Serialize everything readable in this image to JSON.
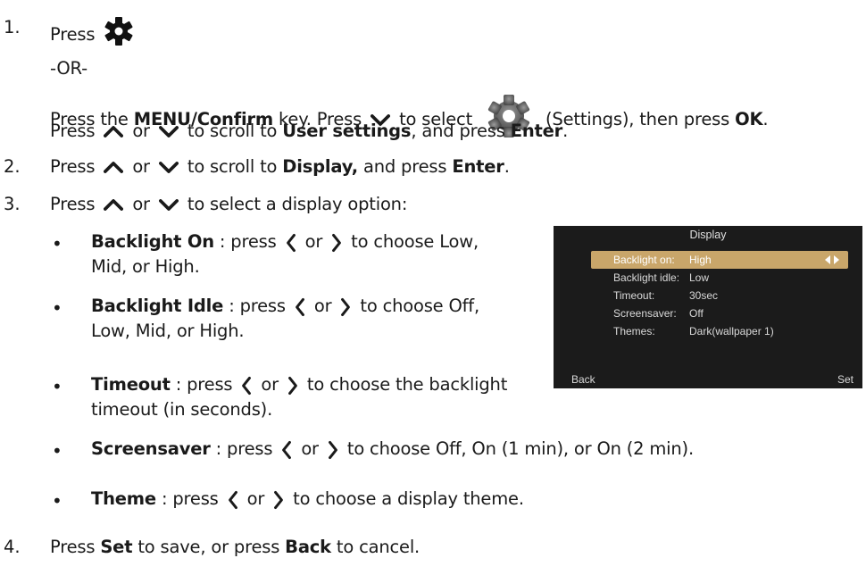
{
  "steps": {
    "s1": {
      "num": "1.",
      "press": "Press",
      "or": "-OR-",
      "l3_a": "Press the ",
      "l3_b": "MENU/Confirm",
      "l3_c": " key. Press ",
      "l3_d": " to select ",
      "l3_e": " (Settings), then press ",
      "l3_f": "OK",
      "l3_g": ".",
      "l4_a": "Press ",
      "l4_b": " or ",
      "l4_c": " to scroll to ",
      "l4_d": "User settings",
      "l4_e": ", and press ",
      "l4_f": "Enter",
      "l4_g": "."
    },
    "s2": {
      "num": "2.",
      "a": "Press ",
      "b": " or ",
      "c": " to scroll to ",
      "d": "Display,",
      "e": " and press ",
      "f": "Enter",
      "g": "."
    },
    "s3": {
      "num": "3.",
      "a": "Press ",
      "b": " or ",
      "c": " to select a display option:"
    },
    "bullets": [
      {
        "title": "Backlight On",
        "lead": " : press ",
        "or": " or ",
        "rest1": " to  choose Low,",
        "rest2": "Mid, or High."
      },
      {
        "title": "Backlight Idle",
        "lead": " : press ",
        "or": " or ",
        "rest1": " to  choose Off,",
        "rest2": "Low, Mid, or High."
      },
      {
        "title": "Timeout",
        "lead": " : press ",
        "or": " or ",
        "rest1": " to  choose the backlight",
        "rest2": "timeout (in seconds)."
      },
      {
        "title": "Screensaver",
        "lead": " : press ",
        "or": " or ",
        "rest1": " to  choose Off, On (1 min), or On (2 min).",
        "rest2": ""
      },
      {
        "title": "Theme",
        "lead": " : press ",
        "or": " or ",
        "rest1": " to  choose a display theme.",
        "rest2": ""
      }
    ],
    "s4": {
      "num": "4.",
      "a": "Press ",
      "b": "Set",
      "c": " to save, or press ",
      "d": "Back",
      "e": " to cancel."
    }
  },
  "display_screen": {
    "title": "Display",
    "rows": [
      {
        "key": "Backlight on:",
        "value": "High",
        "selected": true
      },
      {
        "key": "Backlight idle:",
        "value": "Low",
        "selected": false
      },
      {
        "key": "Timeout:",
        "value": "30sec",
        "selected": false
      },
      {
        "key": "Screensaver:",
        "value": "Off",
        "selected": false
      },
      {
        "key": "Themes:",
        "value": "Dark(wallpaper 1)",
        "selected": false
      }
    ],
    "back": "Back",
    "set": "Set"
  },
  "icons": {
    "gear": "gear-icon",
    "settings": "settings-gear-icon",
    "up": "chevron-up-icon",
    "down": "chevron-down-icon",
    "left": "chevron-left-icon",
    "right": "chevron-right-icon",
    "selector": "left-right-arrows-icon"
  },
  "colors": {
    "text": "#1a1a1a",
    "screen_bg": "#1b1b1b",
    "highlight": "#c9a66a"
  }
}
